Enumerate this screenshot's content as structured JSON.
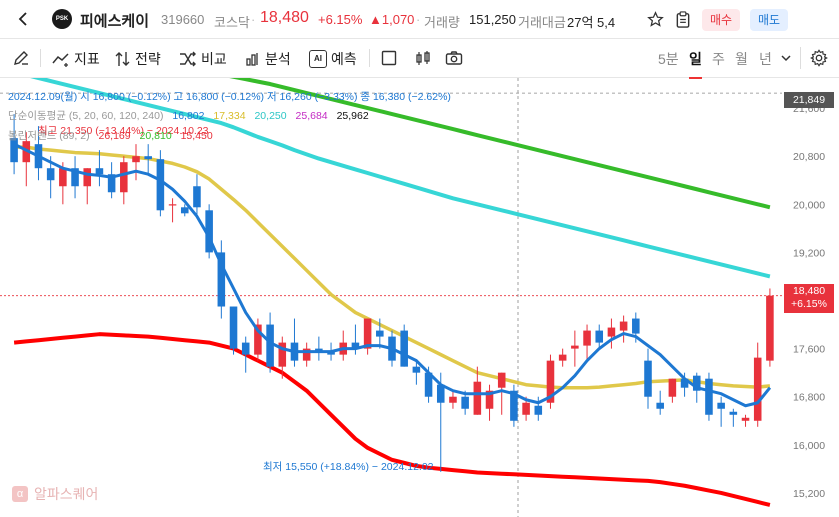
{
  "header": {
    "stock_name": "피에스케이",
    "stock_code": "319660",
    "market": "코스닥",
    "price": "18,480",
    "change_pct": "+6.15%",
    "change_abs": "▲1,070",
    "volume_label": "거래량",
    "volume": "151,250",
    "turnover_label": "거래대금",
    "turnover": "27억 5,4",
    "logo_text": "PSK",
    "buy_label": "매수",
    "sell_label": "매도"
  },
  "toolbar": {
    "indicator": "지표",
    "strategy": "전략",
    "compare": "비교",
    "analysis": "분석",
    "forecast": "예측",
    "ai_badge": "AI",
    "timeframes": [
      "5분",
      "일",
      "주",
      "월",
      "년"
    ],
    "active_timeframe": "일"
  },
  "legend": {
    "line1": "2024.12.09(월)  시 16,800 (−0.12%)  고 16,800 (−0.12%)  저 16,260 (−3.33%)  종 16,380 (−2.62%)",
    "ma_label": "단순이동평균 (5, 20, 60, 120, 240)",
    "ma_values": [
      "16,802",
      "17,334",
      "20,250",
      "25,684",
      "25,962"
    ],
    "high_note": "최고 21,350 (−13.44%) − 2024.10.23",
    "bb_label": "볼린저밴드 (89, 2)",
    "bb_values": [
      "26,169",
      "20,810",
      "15,450"
    ],
    "low_note": "최저 15,550 (+18.84%) − 2024.12.02"
  },
  "y_axis": {
    "ticks": [
      "21,600",
      "20,800",
      "20,000",
      "19,200",
      "18,400",
      "17,600",
      "16,800",
      "16,000",
      "15,200"
    ],
    "hover_price": "21,849",
    "current_price": "18,480",
    "current_pct": "+6.15%"
  },
  "watermark": "알파스퀘어",
  "colors": {
    "up": "#e8323c",
    "down": "#1e78d2",
    "ma5": "#1e78d2",
    "ma20": "#e0c84a",
    "ma60": "#37d6d6",
    "ma120": "#36bb2a",
    "bb_lower": "#ff0000"
  },
  "chart_data": {
    "type": "candlestick",
    "y_range": [
      14800,
      22100
    ],
    "candles": [
      {
        "o": 21100,
        "h": 21500,
        "l": 20500,
        "c": 20700
      },
      {
        "o": 20700,
        "h": 21200,
        "l": 20300,
        "c": 21050
      },
      {
        "o": 21000,
        "h": 21300,
        "l": 20400,
        "c": 20600
      },
      {
        "o": 20600,
        "h": 20800,
        "l": 20100,
        "c": 20400
      },
      {
        "o": 20300,
        "h": 20700,
        "l": 20000,
        "c": 20600
      },
      {
        "o": 20600,
        "h": 20800,
        "l": 20100,
        "c": 20300
      },
      {
        "o": 20300,
        "h": 20600,
        "l": 20000,
        "c": 20600
      },
      {
        "o": 20600,
        "h": 20900,
        "l": 20300,
        "c": 20500
      },
      {
        "o": 20500,
        "h": 20700,
        "l": 20100,
        "c": 20200
      },
      {
        "o": 20200,
        "h": 20800,
        "l": 20000,
        "c": 20700
      },
      {
        "o": 20700,
        "h": 21000,
        "l": 20400,
        "c": 20800
      },
      {
        "o": 20800,
        "h": 21000,
        "l": 20500,
        "c": 20750
      },
      {
        "o": 20750,
        "h": 20900,
        "l": 19800,
        "c": 19900
      },
      {
        "o": 20000,
        "h": 20100,
        "l": 19700,
        "c": 20000
      },
      {
        "o": 19950,
        "h": 20000,
        "l": 19800,
        "c": 19850
      },
      {
        "o": 20300,
        "h": 20500,
        "l": 19800,
        "c": 19950
      },
      {
        "o": 19900,
        "h": 20000,
        "l": 19100,
        "c": 19200
      },
      {
        "o": 19200,
        "h": 19400,
        "l": 18100,
        "c": 18300
      },
      {
        "o": 18300,
        "h": 18300,
        "l": 17500,
        "c": 17600
      },
      {
        "o": 17700,
        "h": 17800,
        "l": 17200,
        "c": 17500
      },
      {
        "o": 17500,
        "h": 18100,
        "l": 17400,
        "c": 18000
      },
      {
        "o": 18000,
        "h": 18200,
        "l": 17200,
        "c": 17300
      },
      {
        "o": 17300,
        "h": 17800,
        "l": 17100,
        "c": 17700
      },
      {
        "o": 17700,
        "h": 18100,
        "l": 17300,
        "c": 17400
      },
      {
        "o": 17400,
        "h": 17700,
        "l": 17300,
        "c": 17600
      },
      {
        "o": 17600,
        "h": 17800,
        "l": 17400,
        "c": 17550
      },
      {
        "o": 17550,
        "h": 17700,
        "l": 17400,
        "c": 17500
      },
      {
        "o": 17500,
        "h": 17900,
        "l": 17400,
        "c": 17700
      },
      {
        "o": 17700,
        "h": 18000,
        "l": 17500,
        "c": 17600
      },
      {
        "o": 17600,
        "h": 18100,
        "l": 17500,
        "c": 18100
      },
      {
        "o": 17900,
        "h": 18100,
        "l": 17600,
        "c": 17800
      },
      {
        "o": 17800,
        "h": 17900,
        "l": 17300,
        "c": 17400
      },
      {
        "o": 17900,
        "h": 18000,
        "l": 17300,
        "c": 17300
      },
      {
        "o": 17300,
        "h": 17400,
        "l": 17000,
        "c": 17200
      },
      {
        "o": 17200,
        "h": 17300,
        "l": 16700,
        "c": 16800
      },
      {
        "o": 17000,
        "h": 17200,
        "l": 15550,
        "c": 16700
      },
      {
        "o": 16700,
        "h": 16900,
        "l": 16600,
        "c": 16800
      },
      {
        "o": 16800,
        "h": 16900,
        "l": 16500,
        "c": 16600
      },
      {
        "o": 16500,
        "h": 17300,
        "l": 16500,
        "c": 17050
      },
      {
        "o": 16600,
        "h": 17000,
        "l": 16400,
        "c": 16900
      },
      {
        "o": 16950,
        "h": 17200,
        "l": 16500,
        "c": 17200
      },
      {
        "o": 16900,
        "h": 17000,
        "l": 16300,
        "c": 16400
      },
      {
        "o": 16500,
        "h": 16800,
        "l": 16400,
        "c": 16700
      },
      {
        "o": 16650,
        "h": 16800,
        "l": 16400,
        "c": 16500
      },
      {
        "o": 16700,
        "h": 17500,
        "l": 16600,
        "c": 17400
      },
      {
        "o": 17400,
        "h": 17600,
        "l": 17300,
        "c": 17500
      },
      {
        "o": 17600,
        "h": 17900,
        "l": 17300,
        "c": 17650
      },
      {
        "o": 17650,
        "h": 18000,
        "l": 17400,
        "c": 17900
      },
      {
        "o": 17900,
        "h": 18000,
        "l": 17600,
        "c": 17700
      },
      {
        "o": 17800,
        "h": 18100,
        "l": 17600,
        "c": 17950
      },
      {
        "o": 17900,
        "h": 18150,
        "l": 17700,
        "c": 18050
      },
      {
        "o": 18100,
        "h": 18200,
        "l": 17700,
        "c": 17850
      },
      {
        "o": 17400,
        "h": 17600,
        "l": 16600,
        "c": 16800
      },
      {
        "o": 16700,
        "h": 16900,
        "l": 16500,
        "c": 16600
      },
      {
        "o": 16800,
        "h": 17100,
        "l": 16700,
        "c": 17100
      },
      {
        "o": 17100,
        "h": 17200,
        "l": 16800,
        "c": 16950
      },
      {
        "o": 17150,
        "h": 17200,
        "l": 16700,
        "c": 16900
      },
      {
        "o": 17100,
        "h": 17200,
        "l": 16400,
        "c": 16500
      },
      {
        "o": 16700,
        "h": 16800,
        "l": 16300,
        "c": 16600
      },
      {
        "o": 16550,
        "h": 16600,
        "l": 16300,
        "c": 16500
      },
      {
        "o": 16400,
        "h": 16500,
        "l": 16300,
        "c": 16450
      },
      {
        "o": 16400,
        "h": 17700,
        "l": 16300,
        "c": 17450
      },
      {
        "o": 17400,
        "h": 18600,
        "l": 17300,
        "c": 18480
      }
    ],
    "ma5": [
      21000,
      20900,
      20800,
      20700,
      20600,
      20550,
      20500,
      20480,
      20450,
      20500,
      20550,
      20500,
      20400,
      20250,
      20050,
      19800,
      19450,
      19000,
      18600,
      18200,
      17900,
      17700,
      17600,
      17550,
      17550,
      17550,
      17550,
      17600,
      17600,
      17650,
      17650,
      17600,
      17500,
      17400,
      17200,
      17000,
      16900,
      16850,
      16850,
      16850,
      16900,
      16850,
      16750,
      16700,
      16800,
      16950,
      17150,
      17400,
      17600,
      17750,
      17850,
      17800,
      17650,
      17500,
      17300,
      17100,
      16950,
      16900,
      16850,
      16750,
      16650,
      16700,
      16950
    ],
    "ma20": [
      20950,
      20950,
      20920,
      20900,
      20880,
      20860,
      20850,
      20840,
      20820,
      20800,
      20780,
      20760,
      20720,
      20680,
      20620,
      20540,
      20420,
      20250,
      20080,
      19900,
      19700,
      19500,
      19300,
      19100,
      18900,
      18700,
      18500,
      18350,
      18200,
      18100,
      18000,
      17900,
      17800,
      17700,
      17600,
      17500,
      17400,
      17300,
      17200,
      17150,
      17100,
      17050,
      17000,
      16980,
      16960,
      16950,
      16950,
      16950,
      16960,
      16980,
      17000,
      17020,
      17050,
      17060,
      17070,
      17080,
      17050,
      17020,
      17000,
      16980,
      16970,
      16960,
      16980
    ],
    "ma60": [
      22200,
      22150,
      22100,
      22050,
      22000,
      21950,
      21900,
      21850,
      21800,
      21750,
      21700,
      21650,
      21600,
      21550,
      21500,
      21450,
      21400,
      21350,
      21280,
      21200,
      21120,
      21050,
      20980,
      20900,
      20830,
      20760,
      20700,
      20640,
      20580,
      20520,
      20460,
      20400,
      20340,
      20280,
      20220,
      20160,
      20100,
      20050,
      20000,
      19950,
      19900,
      19850,
      19800,
      19750,
      19700,
      19650,
      19600,
      19550,
      19500,
      19450,
      19400,
      19350,
      19300,
      19250,
      19200,
      19150,
      19100,
      19050,
      19000,
      18950,
      18900,
      18850,
      18800
    ],
    "ma120": [
      22500,
      22480,
      22460,
      22440,
      22420,
      22400,
      22380,
      22360,
      22340,
      22320,
      22300,
      22280,
      22260,
      22240,
      22220,
      22200,
      22180,
      22160,
      22120,
      22080,
      22040,
      22000,
      21950,
      21900,
      21850,
      21800,
      21750,
      21700,
      21650,
      21600,
      21550,
      21500,
      21450,
      21400,
      21350,
      21300,
      21250,
      21200,
      21150,
      21100,
      21050,
      21000,
      20950,
      20900,
      20850,
      20800,
      20750,
      20700,
      20650,
      20600,
      20550,
      20500,
      20450,
      20400,
      20350,
      20300,
      20250,
      20200,
      20150,
      20100,
      20050,
      20000,
      19950
    ],
    "bb_lower": [
      17700,
      17720,
      17740,
      17760,
      17780,
      17800,
      17820,
      17840,
      17830,
      17820,
      17810,
      17800,
      17780,
      17760,
      17740,
      17720,
      17700,
      17650,
      17600,
      17500,
      17400,
      17300,
      17200,
      17050,
      16900,
      16700,
      16500,
      16300,
      16100,
      15950,
      15850,
      15750,
      15700,
      15650,
      15620,
      15600,
      15580,
      15560,
      15540,
      15530,
      15520,
      15510,
      15500,
      15490,
      15480,
      15470,
      15460,
      15450,
      15440,
      15430,
      15420,
      15410,
      15400,
      15380,
      15350,
      15320,
      15280,
      15240,
      15200,
      15150,
      15100,
      15050,
      15000
    ]
  }
}
